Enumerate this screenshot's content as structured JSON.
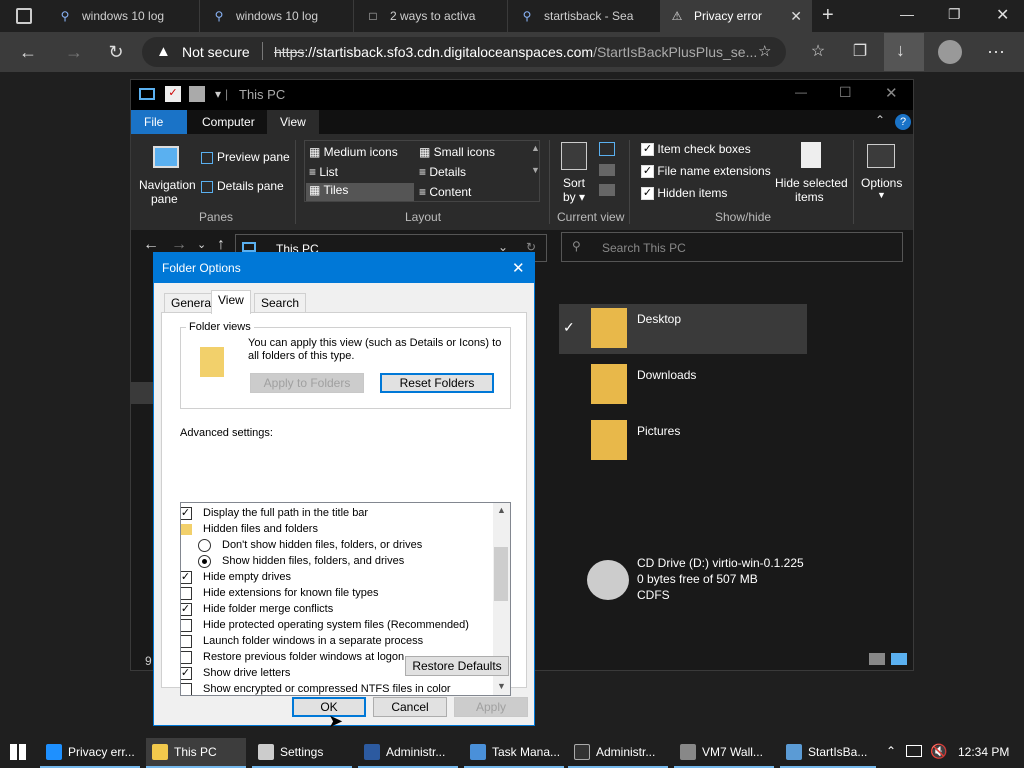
{
  "browser": {
    "tabs": [
      {
        "label": "windows 10 log",
        "icon": "search-icon"
      },
      {
        "label": "windows 10 log",
        "icon": "search-icon"
      },
      {
        "label": "2 ways to activa",
        "icon": "page-icon"
      },
      {
        "label": "startisback - Sea",
        "icon": "search-icon"
      },
      {
        "label": "Privacy error",
        "icon": "warning-page-icon",
        "active": true
      }
    ],
    "security_label": "Not secure",
    "url_scheme": "https",
    "url_host": "://startisback.sfo3.cdn.digitaloceanspaces.com",
    "url_path": "/StartIsBackPlusPlus_se..."
  },
  "explorer": {
    "title": "This PC",
    "ribbon_tabs": [
      "File",
      "Computer",
      "View"
    ],
    "panes": {
      "navigation": "Navigation",
      "navigation2": "pane",
      "preview": "Preview pane",
      "details": "Details pane",
      "group": "Panes"
    },
    "layout": {
      "items": [
        "Medium icons",
        "Small icons",
        "List",
        "Details",
        "Tiles",
        "Content"
      ],
      "group": "Layout"
    },
    "current_view": {
      "sort": "Sort",
      "sort2": "by",
      "group": "Current view"
    },
    "show_hide": {
      "item_check_boxes": "Item check boxes",
      "file_name_extensions": "File name extensions",
      "hidden_items": "Hidden items",
      "hide_selected": "Hide selected",
      "hide_selected2": "items",
      "group": "Show/hide"
    },
    "options": "Options",
    "breadcrumb": "This PC",
    "search_placeholder": "Search This PC",
    "items": [
      {
        "name": "Desktop"
      },
      {
        "name": "Downloads"
      },
      {
        "name": "Pictures"
      }
    ],
    "drive": {
      "name": "CD Drive (D:) virtio-win-0.1.225",
      "free": "0 bytes free of 507 MB",
      "fs": "CDFS"
    },
    "status_count": "9"
  },
  "dialog": {
    "title": "Folder Options",
    "tabs": [
      "General",
      "View",
      "Search"
    ],
    "folder_views_label": "Folder views",
    "folder_views_text1": "You can apply this view (such as Details or Icons) to",
    "folder_views_text2": "all folders of this type.",
    "apply_to_folders": "Apply to Folders",
    "reset_folders": "Reset Folders",
    "advanced_label": "Advanced settings:",
    "advanced": [
      {
        "label": "Display the full path in the title bar",
        "kind": "check",
        "checked": true
      },
      {
        "label": "Hidden files and folders",
        "kind": "folder"
      },
      {
        "label": "Don't show hidden files, folders, or drives",
        "kind": "radio",
        "checked": false
      },
      {
        "label": "Show hidden files, folders, and drives",
        "kind": "radio",
        "checked": true
      },
      {
        "label": "Hide empty drives",
        "kind": "check",
        "checked": true
      },
      {
        "label": "Hide extensions for known file types",
        "kind": "check",
        "checked": false
      },
      {
        "label": "Hide folder merge conflicts",
        "kind": "check",
        "checked": true
      },
      {
        "label": "Hide protected operating system files (Recommended)",
        "kind": "check",
        "checked": false
      },
      {
        "label": "Launch folder windows in a separate process",
        "kind": "check",
        "checked": false
      },
      {
        "label": "Restore previous folder windows at logon",
        "kind": "check",
        "checked": false
      },
      {
        "label": "Show drive letters",
        "kind": "check",
        "checked": true
      },
      {
        "label": "Show encrypted or compressed NTFS files in color",
        "kind": "check",
        "checked": false
      }
    ],
    "restore_defaults": "Restore Defaults",
    "ok": "OK",
    "cancel": "Cancel",
    "apply": "Apply"
  },
  "taskbar": {
    "items": [
      {
        "label": "Privacy err...",
        "color": "#1e90ff"
      },
      {
        "label": "This PC",
        "color": "#f2c94c",
        "active": true
      },
      {
        "label": "Settings",
        "color": "#cccccc"
      },
      {
        "label": "Administr...",
        "color": "#2c5aa0"
      },
      {
        "label": "Task Mana...",
        "color": "#4a90d9"
      },
      {
        "label": "Administr...",
        "color": "#333333"
      },
      {
        "label": "VM7 Wall...",
        "color": "#888888"
      },
      {
        "label": "StartIsBa...",
        "color": "#5b9bd5"
      }
    ],
    "time": "12:34 PM"
  }
}
